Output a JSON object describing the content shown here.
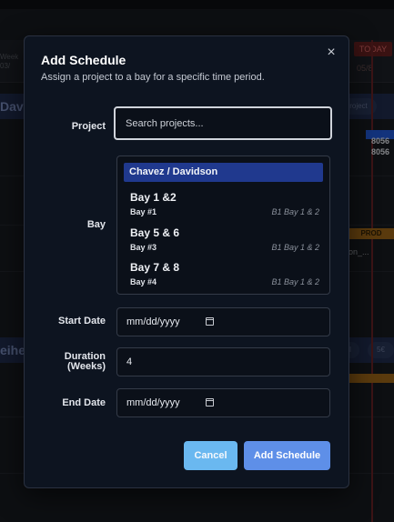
{
  "background": {
    "week_label": "Week 03/",
    "today_label": "TODAY",
    "today_date": "05/8",
    "band1_text": "Dav",
    "band1_pill": "roject",
    "band2_text": "eihe",
    "band2_pill_a": "l",
    "band2_pill_b": "5€",
    "item_numbers": [
      "8056",
      "8056"
    ],
    "prod_badge": "PROD",
    "item_text": "on_..."
  },
  "modal": {
    "title": "Add Schedule",
    "subtitle": "Assign a project to a bay for a specific time period.",
    "close_glyph": "×",
    "project_label": "Project",
    "project_placeholder": "Search projects...",
    "bay_label": "Bay",
    "bay_group": "Chavez / Davidson",
    "bays": [
      {
        "name": "Bay 1 &2",
        "sub": "Bay #1",
        "right": "B1 Bay 1 & 2"
      },
      {
        "name": "Bay 5 & 6",
        "sub": "Bay #3",
        "right": "B1 Bay 1 & 2"
      },
      {
        "name": "Bay 7 & 8",
        "sub": "Bay #4",
        "right": "B1 Bay 1 & 2"
      }
    ],
    "start_date_label": "Start Date",
    "start_date_value": "mm/dd/yyyy",
    "duration_label_line1": "Duration",
    "duration_label_line2": "(Weeks)",
    "duration_value": "4",
    "end_date_label": "End Date",
    "end_date_value": "mm/dd/yyyy",
    "cancel_label": "Cancel",
    "submit_label": "Add Schedule"
  }
}
